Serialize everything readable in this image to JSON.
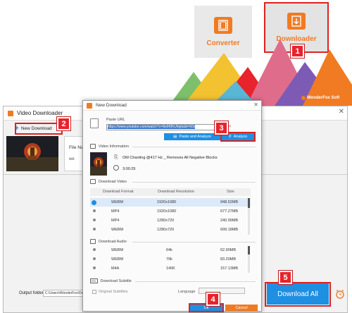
{
  "launcher": {
    "converter_label": "Converter",
    "downloader_label": "Downloader",
    "brand": "WonderFox Soft"
  },
  "markers": [
    "1",
    "2",
    "3",
    "4",
    "5"
  ],
  "main_window": {
    "title": "Video Downloader",
    "new_download_label": "New Download",
    "file_name_label": "File Na",
    "file_prefix": "we",
    "output_folder_label": "Output folder:",
    "output_folder_value": "C:\\Users\\WonderFox\\Desk",
    "download_all_label": "Download All"
  },
  "dialog": {
    "title": "New Download",
    "paste_url_label": "Paste URL",
    "url_value": "https://www.youtube.com/watch?v=8e9KfhU6qtts&t=60s",
    "paste_and_analyze_label": "Paste and Analyze",
    "analyze_label": "Analyze",
    "video_information_label": "Video Information",
    "video_title": "OM Chanting @417 Hz _ Removes All Negative Blocks",
    "video_duration": "3:00:29",
    "download_video_label": "Download Video",
    "columns": [
      "Download Format",
      "Download Resolution",
      "Size"
    ],
    "video_rows": [
      {
        "format": "WEBM",
        "resolution": "1920x1080",
        "size": "948.52MB",
        "selected": true
      },
      {
        "format": "MP4",
        "resolution": "1920x1080",
        "size": "677.27MB",
        "selected": false
      },
      {
        "format": "MP4",
        "resolution": "1280x720",
        "size": "240.99MB",
        "selected": false
      },
      {
        "format": "WEBM",
        "resolution": "1280x720",
        "size": "699.18MB",
        "selected": false
      }
    ],
    "download_audio_label": "Download Audio",
    "audio_rows": [
      {
        "format": "WEBM",
        "bitrate": "64k",
        "size": "62.90MB"
      },
      {
        "format": "WEBM",
        "bitrate": "79k",
        "size": "83.20MB"
      },
      {
        "format": "M4A",
        "bitrate": "140K",
        "size": "157.13MB"
      }
    ],
    "download_subtitle_label": "Download Subtitle",
    "original_subtitles_label": "Original Subtitles",
    "language_label": "Language",
    "ok_label": "Ok",
    "cancel_label": "Cancel"
  },
  "colors": {
    "accent_orange": "#f07b23",
    "primary_blue": "#1e8fe1",
    "marker_red": "#e8232b"
  }
}
